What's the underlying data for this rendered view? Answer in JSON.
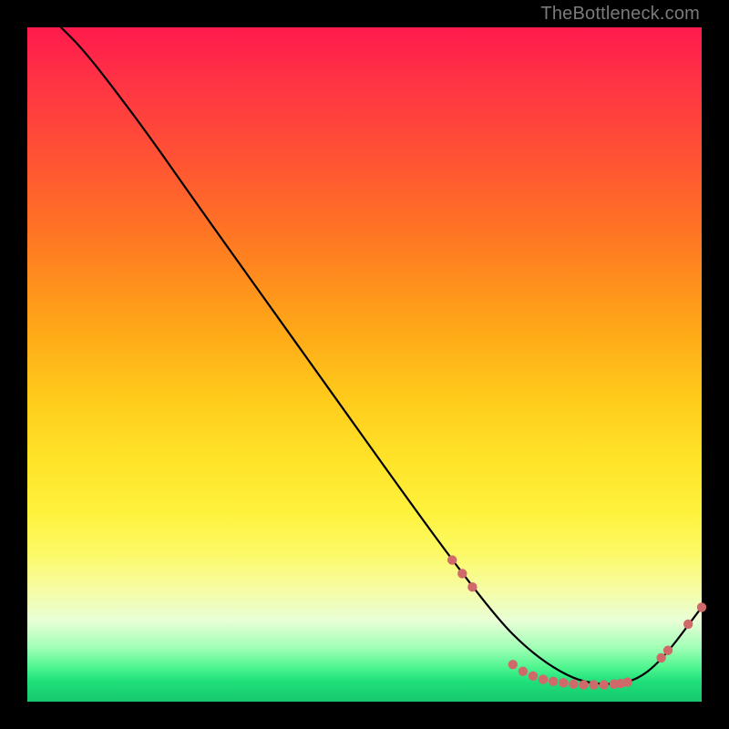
{
  "watermark": "TheBottleneck.com",
  "chart_data": {
    "type": "line",
    "title": "",
    "xlabel": "",
    "ylabel": "",
    "xlim": [
      0,
      100
    ],
    "ylim": [
      0,
      100
    ],
    "curve": {
      "x": [
        5,
        8,
        12,
        18,
        25,
        35,
        45,
        55,
        63,
        70,
        74,
        78,
        82,
        86,
        90,
        94,
        100
      ],
      "y": [
        100,
        97,
        92,
        84,
        74,
        60,
        46,
        32,
        21,
        12,
        8,
        5,
        3,
        2.5,
        3,
        6,
        14
      ]
    },
    "markers": [
      {
        "x": 63,
        "y": 21
      },
      {
        "x": 64.5,
        "y": 19
      },
      {
        "x": 66,
        "y": 17
      },
      {
        "x": 72,
        "y": 5.5
      },
      {
        "x": 73.5,
        "y": 4.5
      },
      {
        "x": 75,
        "y": 3.8
      },
      {
        "x": 76.5,
        "y": 3.3
      },
      {
        "x": 78,
        "y": 3
      },
      {
        "x": 79.5,
        "y": 2.8
      },
      {
        "x": 81,
        "y": 2.6
      },
      {
        "x": 82.5,
        "y": 2.5
      },
      {
        "x": 84,
        "y": 2.5
      },
      {
        "x": 85.5,
        "y": 2.5
      },
      {
        "x": 87,
        "y": 2.6
      },
      {
        "x": 88,
        "y": 2.7
      },
      {
        "x": 89,
        "y": 2.9
      },
      {
        "x": 94,
        "y": 6.5
      },
      {
        "x": 95,
        "y": 7.6
      },
      {
        "x": 98,
        "y": 11.5
      },
      {
        "x": 100,
        "y": 14
      }
    ],
    "marker_color": "#d06a6a",
    "curve_color": "#000000"
  }
}
